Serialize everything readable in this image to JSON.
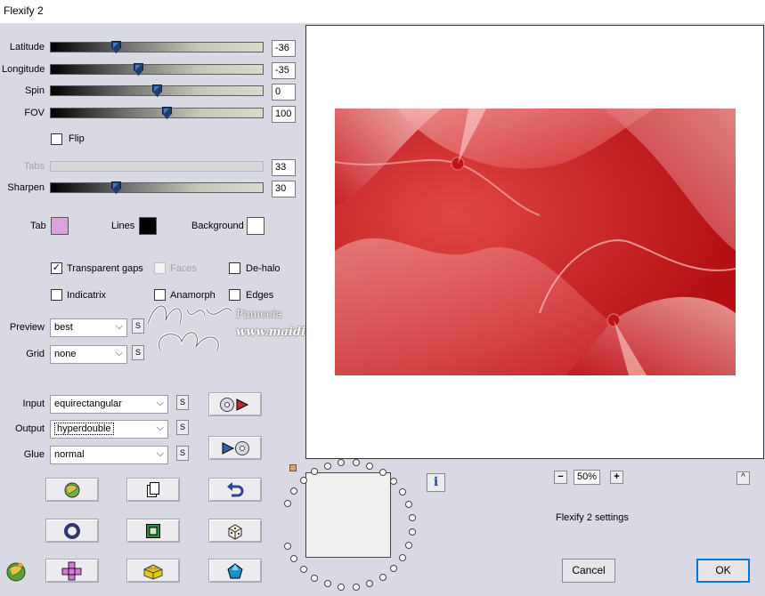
{
  "window": {
    "title": "Flexify 2"
  },
  "sliders": [
    {
      "label": "Latitude",
      "value": "-36",
      "level": 0.3,
      "enabled": true
    },
    {
      "label": "Longitude",
      "value": "-35",
      "level": 0.41,
      "enabled": true
    },
    {
      "label": "Spin",
      "value": "0",
      "level": 0.5,
      "enabled": true
    },
    {
      "label": "FOV",
      "value": "100",
      "level": 0.55,
      "enabled": true
    }
  ],
  "flip": {
    "label": "Flip",
    "checked": false
  },
  "tabs_slider": {
    "label": "Tabs",
    "value": "33",
    "enabled": false
  },
  "sharpen": {
    "label": "Sharpen",
    "value": "30",
    "level": 0.3
  },
  "colors": {
    "tab": {
      "label": "Tab",
      "color": "#dba3dc"
    },
    "lines": {
      "label": "Lines",
      "color": "#000000"
    },
    "background": {
      "label": "Background",
      "color": "#ffffff"
    }
  },
  "options": {
    "transparent_gaps": {
      "label": "Transparent gaps",
      "checked": true,
      "enabled": true,
      "mark": "✓"
    },
    "faces": {
      "label": "Faces",
      "checked": false,
      "enabled": false
    },
    "de_halo": {
      "label": "De-halo",
      "checked": false,
      "enabled": true
    },
    "indicatrix": {
      "label": "Indicatrix",
      "checked": false,
      "enabled": true
    },
    "anamorph": {
      "label": "Anamorph",
      "checked": false,
      "enabled": true
    },
    "edges": {
      "label": "Edges",
      "checked": false,
      "enabled": true
    }
  },
  "preview_select": {
    "label": "Preview",
    "value": "best"
  },
  "grid_select": {
    "label": "Grid",
    "value": "none"
  },
  "input_select": {
    "label": "Input",
    "value": "equirectangular"
  },
  "output_select": {
    "label": "Output",
    "value": "hyperdouble"
  },
  "glue_select": {
    "label": "Glue",
    "value": "normal"
  },
  "s_button_label": "S",
  "chevron": "⌵",
  "watermark": {
    "line1": "Pinuccia",
    "line2": "www.maidiregrafica.eu",
    "signature": "Merry Christmas"
  },
  "zoom": {
    "minus": "−",
    "value": "50%",
    "plus": "+"
  },
  "info_button": "i",
  "collapse_button": "^",
  "settings_label": "Flexify 2 settings",
  "cancel_label": "Cancel",
  "ok_label": "OK",
  "accent_colors": {
    "art_red": "#d32a2a",
    "ok_border": "#0078d7"
  }
}
